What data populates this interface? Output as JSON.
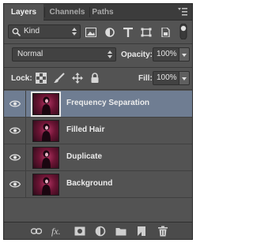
{
  "tabs": [
    {
      "label": "Layers",
      "active": true
    },
    {
      "label": "Channels",
      "active": false
    },
    {
      "label": "Paths",
      "active": false
    }
  ],
  "filter": {
    "kind_label": "Kind"
  },
  "blend": {
    "mode": "Normal",
    "opacity_label": "Opacity:",
    "opacity_value": "100%"
  },
  "lock": {
    "label": "Lock:",
    "fill_label": "Fill:",
    "fill_value": "100%"
  },
  "layers": [
    {
      "name": "Frequency Separation",
      "visible": true,
      "selected": true
    },
    {
      "name": "Filled Hair",
      "visible": true,
      "selected": false
    },
    {
      "name": "Duplicate",
      "visible": true,
      "selected": false
    },
    {
      "name": "Background",
      "visible": true,
      "selected": false
    }
  ],
  "toolbar": {
    "fx_label": "fx."
  },
  "colors": {
    "panel_bg": "#535353",
    "selection": "#6f7d92",
    "thumbnail": "#b23463"
  }
}
